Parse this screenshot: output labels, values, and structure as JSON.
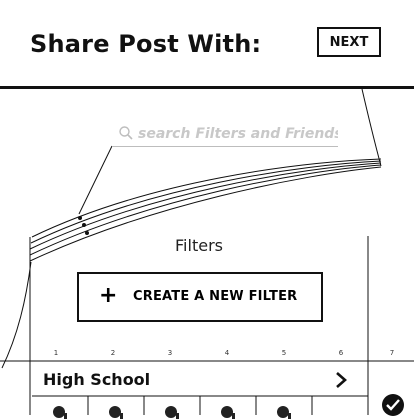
{
  "header": {
    "title": "Share Post With:",
    "next_label": "NEXT"
  },
  "search": {
    "placeholder": "search Filters and Friends",
    "icon": "search-icon"
  },
  "filters": {
    "section_label": "Filters",
    "create_button": {
      "icon": "plus-icon",
      "label": "CREATE A NEW FILTER"
    },
    "column_numbers": [
      "1",
      "2",
      "3",
      "4",
      "5",
      "6",
      "7"
    ],
    "items": [
      {
        "label": "High School",
        "icon": "chevron-right-icon"
      }
    ]
  },
  "selection": {
    "icon": "checkmark-icon"
  },
  "colors": {
    "ink": "#111111",
    "placeholder": "#c8c8c8",
    "background": "#ffffff"
  }
}
